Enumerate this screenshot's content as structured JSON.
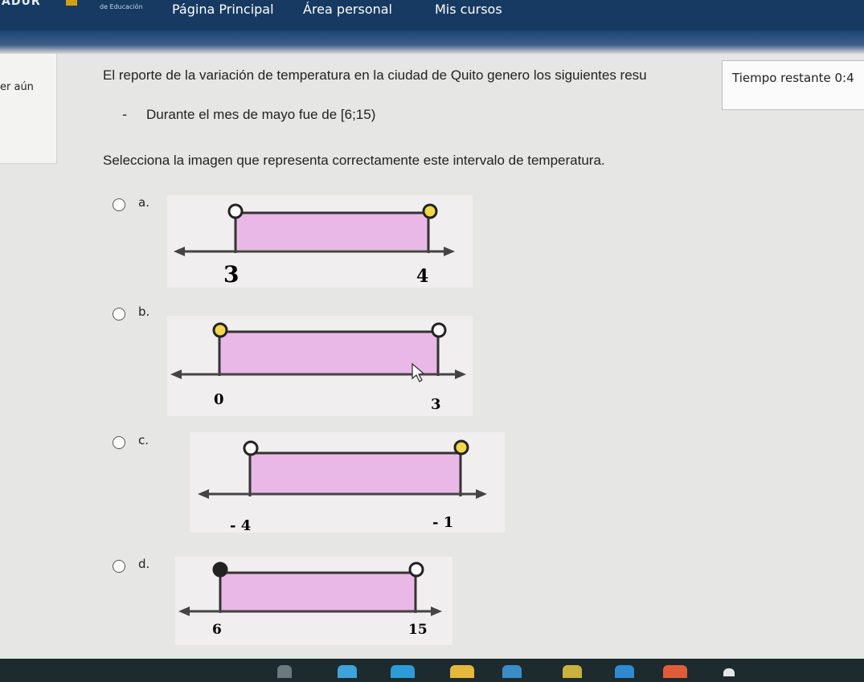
{
  "header": {
    "logo": "ADUR",
    "logo_sub": "de Educación",
    "nav": [
      "Página Principal",
      "Área personal",
      "Mis cursos"
    ]
  },
  "left_block": {
    "text": "er aún"
  },
  "timer": {
    "label": "Tiempo restante 0:4"
  },
  "question": {
    "text": "El reporte de la variación de temperatura en la ciudad de Quito genero los siguientes resu",
    "dash": "-",
    "sub": "Durante el mes de mayo fue de [6;15)",
    "instruction": "Selecciona la imagen que representa correctamente este intervalo de temperatura."
  },
  "options": [
    {
      "letter": "a.",
      "left_value": "3",
      "right_value": "4",
      "left_point": "open",
      "right_point": "open",
      "selected": false
    },
    {
      "letter": "b.",
      "left_value": "0",
      "right_value": "3",
      "left_point": "open",
      "right_point": "open",
      "selected": false
    },
    {
      "letter": "c.",
      "left_value": "- 4",
      "right_value": "- 1",
      "left_point": "open",
      "right_point": "open",
      "selected": false
    },
    {
      "letter": "d.",
      "left_value": "6",
      "right_value": "15",
      "left_point": "closed",
      "right_point": "open",
      "selected": false
    }
  ],
  "colors": {
    "nav_bg": "#173a63",
    "interval_fill": "#eab8e6",
    "closed_point": "#222222",
    "open_point_a_c": "#f2d64b",
    "open_point": "#ffffff"
  }
}
